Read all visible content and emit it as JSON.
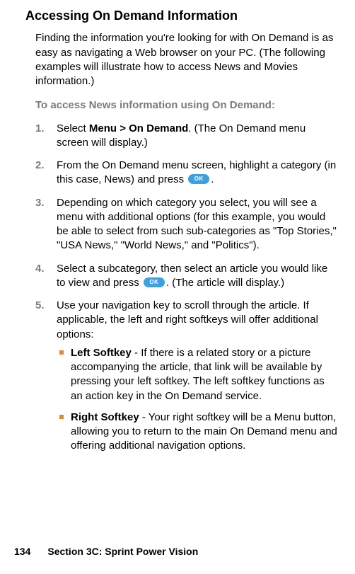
{
  "title": "Accessing On Demand Information",
  "intro": "Finding the information you're looking for with On Demand is as easy as navigating a Web browser on your PC. (The following examples will illustrate how to access News and Movies information.)",
  "subhead": "To access News information using On Demand:",
  "ok_label": "OK",
  "steps": [
    {
      "num": "1.",
      "pre": "Select ",
      "bold": "Menu > On Demand",
      "post": ". (The On Demand menu screen will display.)"
    },
    {
      "num": "2.",
      "pre": "From the On Demand menu screen, highlight a category (in this case, News) and press ",
      "ok": true,
      "post2": "."
    },
    {
      "num": "3.",
      "pre": "Depending on which category you select, you will see a menu with additional options (for this example, you would be able to select from such sub-categories as \"Top Stories,\" \"USA News,\" \"World News,\" and \"Politics\")."
    },
    {
      "num": "4.",
      "pre": "Select a subcategory, then select an article you would like to view and press ",
      "ok": true,
      "post2": ". (The article will display.)"
    },
    {
      "num": "5.",
      "pre": "Use your navigation key to scroll through the article. If applicable, the left and right softkeys will offer additional options:"
    }
  ],
  "bullets": [
    {
      "bold": "Left Softkey",
      "text": " - If there is a related story or a picture accompanying the article, that link will be available by pressing your left softkey. The left softkey functions as an action key in the On Demand service."
    },
    {
      "bold": "Right Softkey",
      "text": " - Your right softkey will be a Menu button, allowing you to return to the main On Demand menu and offering additional navigation options."
    }
  ],
  "footer": {
    "page": "134",
    "section": "Section 3C: Sprint Power Vision"
  }
}
